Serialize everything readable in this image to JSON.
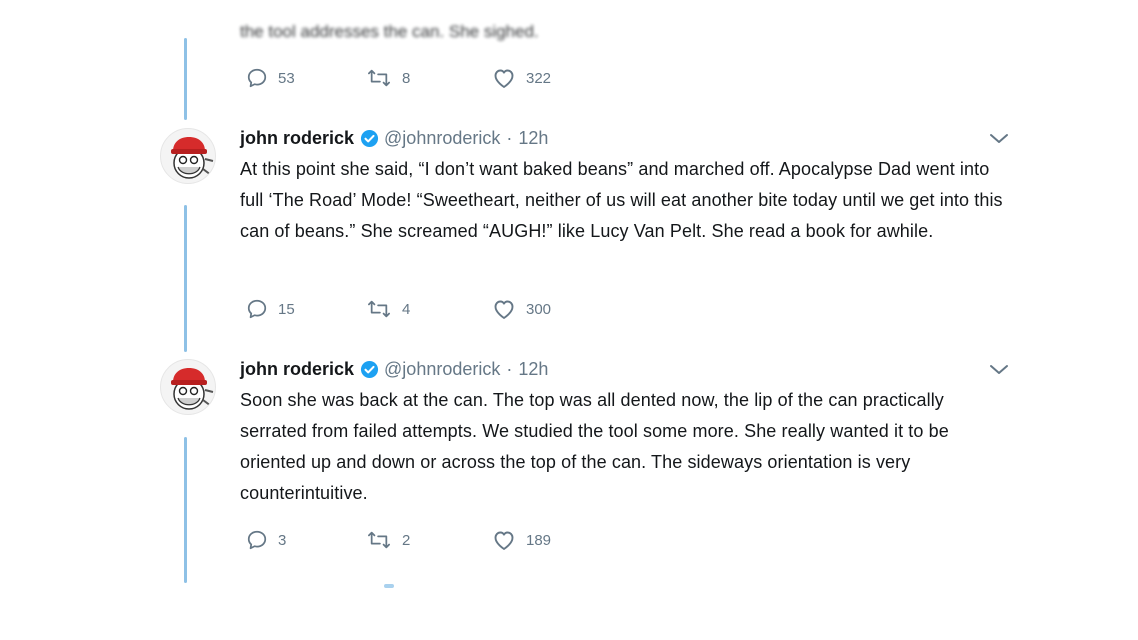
{
  "top_partial": {
    "text": "the tool addresses the can. She sighed.",
    "replies": "53",
    "retweets": "8",
    "likes": "322"
  },
  "tweets": [
    {
      "name": "john roderick",
      "handle": "@johnroderick",
      "separator": "·",
      "time": "12h",
      "text": "At this point she said, “I don’t want baked beans” and marched off. Apocalypse Dad went into full ‘The Road’ Mode! “Sweetheart, neither of us will eat another bite today until we get into this can of beans.” She screamed “AUGH!” like Lucy Van Pelt. She read a book for awhile.",
      "replies": "15",
      "retweets": "4",
      "likes": "300"
    },
    {
      "name": "john roderick",
      "handle": "@johnroderick",
      "separator": "·",
      "time": "12h",
      "text": "Soon she was back at the can. The top was all dented now, the lip of the can practically serrated from failed attempts. We studied the tool some more. She really wanted it to be oriented up and down or across the top of the can. The sideways orientation is very counterintuitive.",
      "replies": "3",
      "retweets": "2",
      "likes": "189"
    }
  ],
  "colors": {
    "thread_line": "#8ec1e6",
    "verified": "#1da1f2",
    "meta_gray": "#657786",
    "avatar_hat": "#d62b2b"
  },
  "icons": [
    "reply-icon",
    "retweet-icon",
    "like-icon",
    "verified-icon",
    "chevron-down-icon"
  ]
}
